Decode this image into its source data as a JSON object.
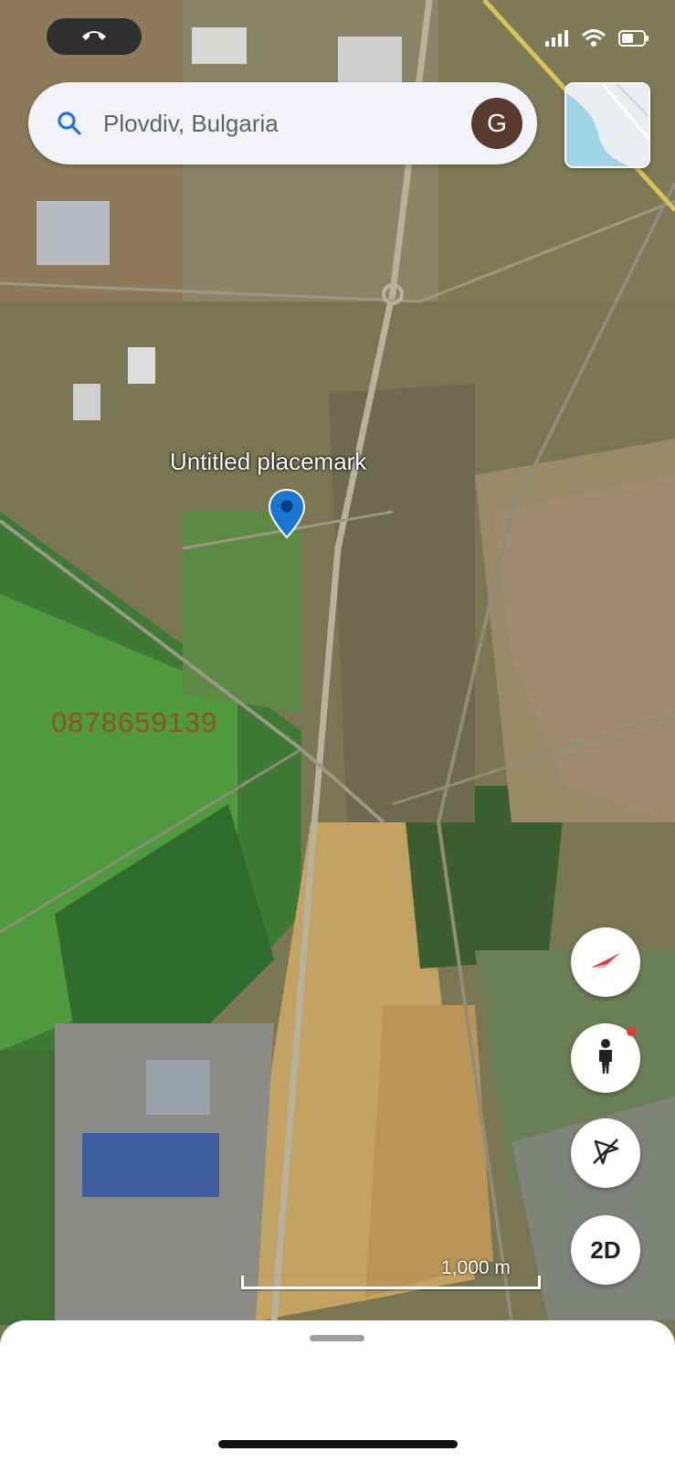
{
  "search": {
    "placeholder": "Plovdiv, Bulgaria",
    "avatar_letter": "G"
  },
  "placemark": {
    "label": "Untitled placemark"
  },
  "watermark": "0878659139",
  "controls": {
    "view_mode_label": "2D"
  },
  "scale": {
    "label": "1,000 m"
  },
  "icons": {
    "call": "phone-icon",
    "search": "search-icon",
    "compass": "compass-icon",
    "pegman": "street-view-icon",
    "location": "location-off-icon"
  },
  "colors": {
    "accent": "#1a73e8",
    "avatar": "#5a3a2e",
    "pin": "#1976d2"
  }
}
